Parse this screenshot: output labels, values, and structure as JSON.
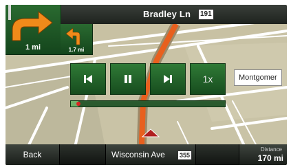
{
  "header": {
    "street_name": "Bradley Ln",
    "road_number": "191"
  },
  "turns": {
    "primary": {
      "distance": "1 mi",
      "icon": "turn-right-arrow-icon",
      "color": "#f08a1a"
    },
    "secondary": {
      "distance": "1.7 mi",
      "icon": "turn-left-arrow-icon",
      "color": "#f08a1a"
    }
  },
  "playback": {
    "prev_icon": "skip-previous-icon",
    "pause_icon": "pause-icon",
    "next_icon": "skip-next-icon",
    "speed_label": "1x",
    "progress_fraction": 0.05
  },
  "map": {
    "poi_label": "Montgomer",
    "route_color": "#e8601e"
  },
  "footer": {
    "back_label": "Back",
    "current_street": "Wisconsin Ave",
    "current_road_number": "355",
    "distance_caption": "Distance",
    "distance_value": "170 mi"
  }
}
